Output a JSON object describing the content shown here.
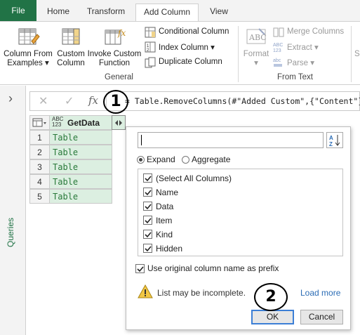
{
  "tabs": {
    "file": "File",
    "home": "Home",
    "transform": "Transform",
    "add_column": "Add Column",
    "view": "View"
  },
  "ribbon": {
    "general": {
      "column_from_examples": [
        "Column From",
        "Examples ▾"
      ],
      "custom_column": [
        "Custom",
        "Column"
      ],
      "invoke_custom_function": [
        "Invoke Custom",
        "Function"
      ],
      "conditional_column": "Conditional Column",
      "index_column": "Index Column ▾",
      "duplicate_column": "Duplicate Column",
      "group_label": "General"
    },
    "from_text": {
      "format": "Format",
      "format_arrow": "▾",
      "merge_columns": "Merge Columns",
      "extract": "Extract ▾",
      "parse": "Parse ▾",
      "group_label": "From Text"
    },
    "overflow_label": "S"
  },
  "left_pane": {
    "expand_arrow": "›",
    "queries_label": "Queries"
  },
  "formula_bar": {
    "cancel_glyph": "✕",
    "commit_glyph": "✓",
    "fx_glyph": "fx",
    "formula": "= Table.RemoveColumns(#\"Added Custom\",{\"Content\"})"
  },
  "grid": {
    "type_icon_top": "ABC",
    "type_icon_bottom": "123",
    "column_header": "GetData",
    "rows": [
      {
        "num": "1",
        "value": "Table"
      },
      {
        "num": "2",
        "value": "Table"
      },
      {
        "num": "3",
        "value": "Table"
      },
      {
        "num": "4",
        "value": "Table"
      },
      {
        "num": "5",
        "value": "Table"
      }
    ]
  },
  "expand_popup": {
    "search_value": "",
    "options": {
      "expand": "Expand",
      "aggregate": "Aggregate",
      "selected": "Expand"
    },
    "columns": [
      {
        "label": "(Select All Columns)",
        "checked": true
      },
      {
        "label": "Name",
        "checked": true
      },
      {
        "label": "Data",
        "checked": true
      },
      {
        "label": "Item",
        "checked": true
      },
      {
        "label": "Kind",
        "checked": true
      },
      {
        "label": "Hidden",
        "checked": true
      }
    ],
    "use_prefix_label": "Use original column name as prefix",
    "use_prefix_checked": true,
    "warning": "List may be incomplete.",
    "load_more": "Load more",
    "ok": "OK",
    "cancel": "Cancel"
  },
  "annotations": {
    "step1": "1",
    "step2": "2"
  },
  "colors": {
    "brand_green": "#217346",
    "table_cell_bg": "#dcefe1",
    "link_blue": "#2b6cb5",
    "ok_border": "#3c7fd6"
  }
}
